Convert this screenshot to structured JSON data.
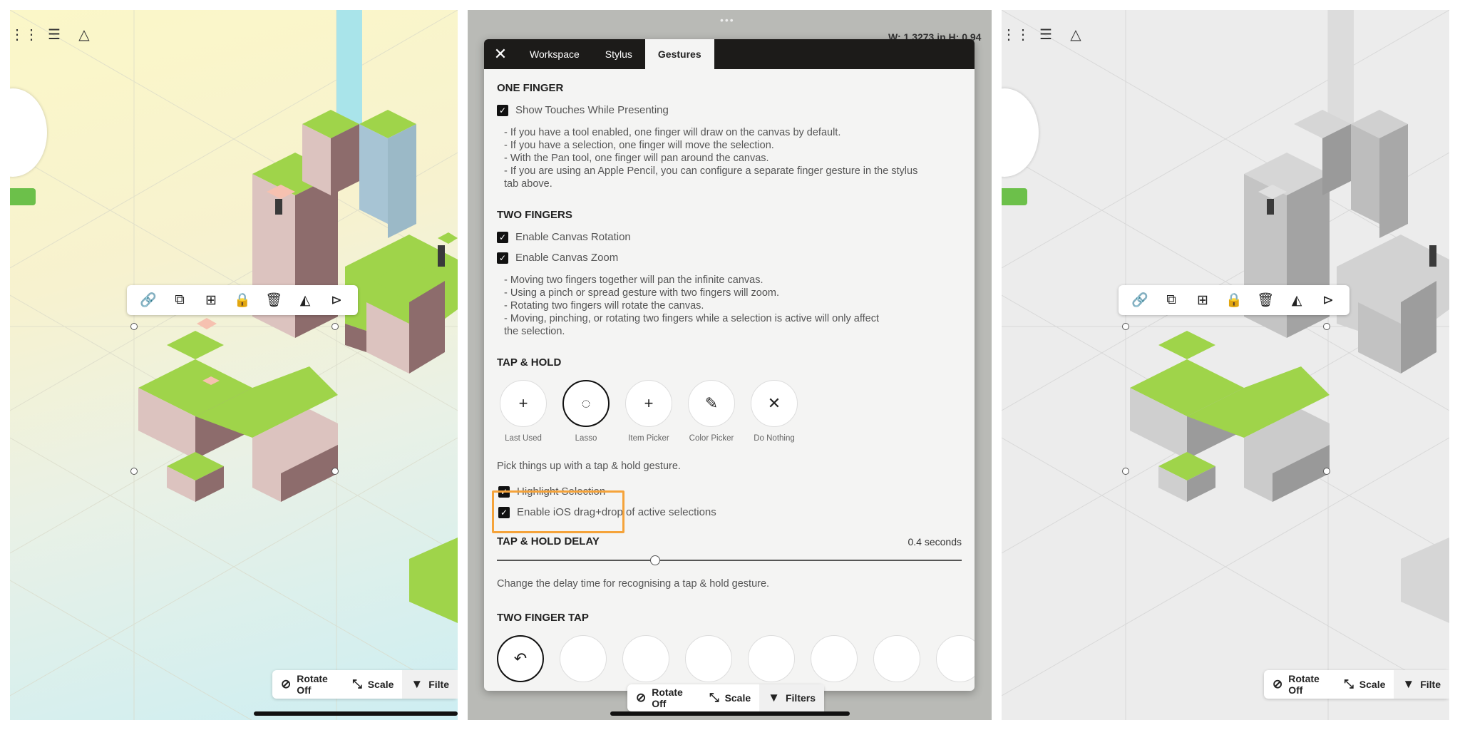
{
  "left": {
    "bottom_bar": {
      "rotate": "Rotate Off",
      "scale": "Scale",
      "filters": "Filte"
    }
  },
  "middle": {
    "dimension_readout": "W: 1.3273 in   H: 0.94",
    "bottom_bar": {
      "rotate": "Rotate Off",
      "scale": "Scale",
      "filters": "Filters"
    }
  },
  "right": {
    "bottom_bar": {
      "rotate": "Rotate Off",
      "scale": "Scale",
      "filters": "Filte"
    }
  },
  "dialog": {
    "tabs": [
      "Workspace",
      "Stylus",
      "Gestures"
    ],
    "active_tab": "Gestures",
    "one_finger": {
      "title": "ONE FINGER",
      "show_touches": "Show Touches While Presenting",
      "lines": [
        "- If you have a tool enabled, one finger will draw on the canvas by default.",
        "- If you have a selection, one finger will move the selection.",
        "- With the Pan tool, one finger will pan around the canvas.",
        "- If you are using an Apple Pencil, you can configure a separate finger gesture in the stylus",
        "tab above."
      ]
    },
    "two_fingers": {
      "title": "TWO FINGERS",
      "rotation": "Enable Canvas Rotation",
      "zoom": "Enable Canvas Zoom",
      "lines": [
        "- Moving two fingers together will pan the infinite canvas.",
        "- Using a pinch or spread gesture with two fingers will zoom.",
        "- Rotating two fingers will rotate the canvas.",
        "- Moving, pinching, or rotating two fingers while a selection is active will only affect",
        "the selection."
      ]
    },
    "tap_hold": {
      "title": "TAP & HOLD",
      "options": [
        "Last Used",
        "Lasso",
        "Item Picker",
        "Color Picker",
        "Do Nothing"
      ],
      "selected": "Lasso",
      "hint": "Pick things up with a tap & hold gesture.",
      "highlight": "Highlight Selection",
      "drag_drop": "Enable iOS drag+drop of active selections"
    },
    "delay": {
      "title": "TAP & HOLD DELAY",
      "value_text": "0.4 seconds",
      "fraction": 0.34,
      "hint": "Change the delay time for recognising a tap & hold gesture."
    },
    "two_finger_tap": {
      "title": "TWO FINGER TAP"
    }
  },
  "colors": {
    "accent": "#f5a33a",
    "grass": "#9fd44a",
    "dirt": "#dcc3bf",
    "highlight_box": "#f5a33a"
  }
}
